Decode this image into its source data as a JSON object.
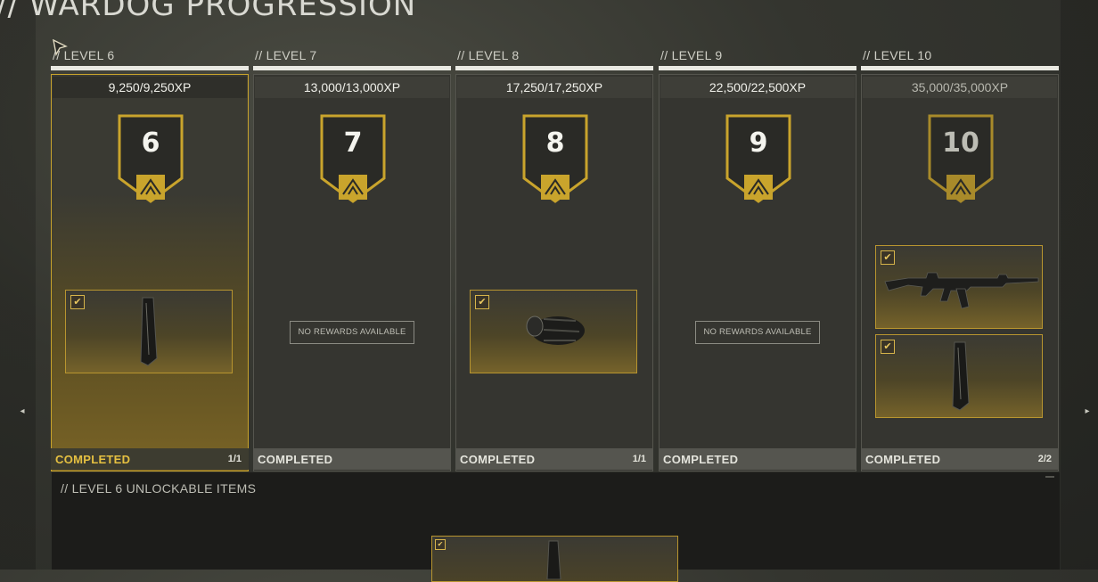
{
  "page": {
    "title": "// WARDOG PROGRESSION"
  },
  "levels": [
    {
      "label": "// LEVEL 6",
      "xp": "9,250/9,250XP",
      "badge": "6",
      "status": "COMPLETED",
      "count": "1/1",
      "no_rewards": ""
    },
    {
      "label": "// LEVEL 7",
      "xp": "13,000/13,000XP",
      "badge": "7",
      "status": "COMPLETED",
      "count": "",
      "no_rewards": "NO REWARDS AVAILABLE"
    },
    {
      "label": "// LEVEL 8",
      "xp": "17,250/17,250XP",
      "badge": "8",
      "status": "COMPLETED",
      "count": "1/1",
      "no_rewards": ""
    },
    {
      "label": "// LEVEL 9",
      "xp": "22,500/22,500XP",
      "badge": "9",
      "status": "COMPLETED",
      "count": "",
      "no_rewards": "NO REWARDS AVAILABLE"
    },
    {
      "label": "// LEVEL 10",
      "xp": "35,000/35,000XP",
      "badge": "10",
      "status": "COMPLETED",
      "count": "2/2",
      "no_rewards": ""
    }
  ],
  "unlockables": {
    "title": "// LEVEL 6 UNLOCKABLE ITEMS"
  },
  "icons": {
    "cursor": "cursor-arrow-icon",
    "check": "checkbox-checked-icon",
    "emblem": "wardog-emblem-icon",
    "magazine": "magazine-icon",
    "muzzle": "muzzle-brake-icon",
    "rifle": "assault-rifle-icon",
    "nav_left": "chevron-left-icon",
    "nav_right": "chevron-right-icon"
  },
  "colors": {
    "accent_gold": "#c9a42c",
    "status_gold": "#e5c041",
    "panel": "#353530"
  }
}
